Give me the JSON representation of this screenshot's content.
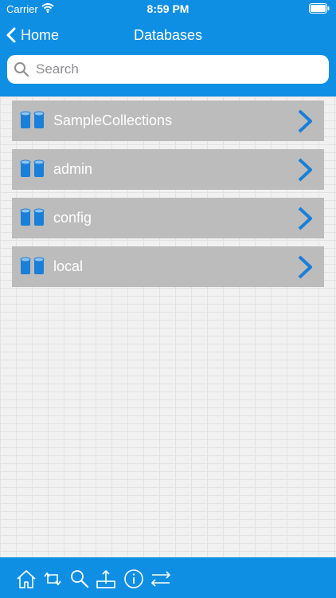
{
  "status_bar": {
    "carrier": "Carrier",
    "time": "8:59 PM"
  },
  "nav": {
    "back_label": "Home",
    "title": "Databases"
  },
  "search": {
    "placeholder": "Search",
    "value": ""
  },
  "databases": [
    {
      "name": "SampleCollections",
      "icon": "database-icon"
    },
    {
      "name": "admin",
      "icon": "database-icon"
    },
    {
      "name": "config",
      "icon": "database-icon"
    },
    {
      "name": "local",
      "icon": "database-icon"
    }
  ],
  "tab_bar": [
    {
      "icon": "home-icon"
    },
    {
      "icon": "refresh-icon"
    },
    {
      "icon": "search-icon"
    },
    {
      "icon": "upload-icon"
    },
    {
      "icon": "info-icon"
    },
    {
      "icon": "transfer-icon"
    }
  ],
  "colors": {
    "header": "#0f8fe3",
    "row": "#bcbcbc",
    "accent": "#1a7fd8",
    "background": "#f1f1f1"
  }
}
